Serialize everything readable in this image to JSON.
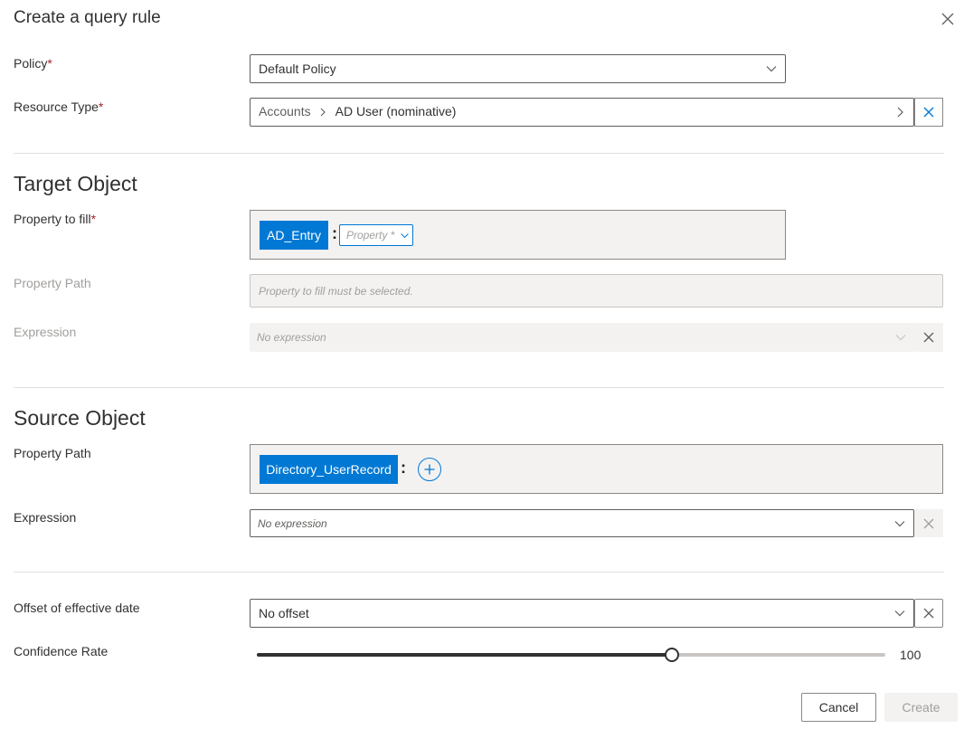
{
  "dialog": {
    "title": "Create a query rule"
  },
  "policy": {
    "label": "Policy",
    "value": "Default Policy"
  },
  "resource_type": {
    "label": "Resource Type",
    "crumb_1": "Accounts",
    "crumb_sep": ">",
    "crumb_2": "AD User (nominative)"
  },
  "target": {
    "heading": "Target Object",
    "property_to_fill_label": "Property to fill",
    "chip": "AD_Entry",
    "colon": ":",
    "property_placeholder": "Property *",
    "property_path_label": "Property Path",
    "property_path_value": "Property to fill must be selected.",
    "expression_label": "Expression",
    "expression_value": "No expression"
  },
  "source": {
    "heading": "Source Object",
    "property_path_label": "Property Path",
    "chip": "Directory_UserRecord",
    "colon": ":",
    "expression_label": "Expression",
    "expression_value": "No expression"
  },
  "offset": {
    "label": "Offset of effective date",
    "value": "No offset"
  },
  "confidence": {
    "label": "Confidence Rate",
    "value": "100",
    "fill_fraction": 0.66
  },
  "buttons": {
    "cancel": "Cancel",
    "create": "Create"
  },
  "required_marker": "*",
  "colors": {
    "accent": "#0078d4",
    "required": "#a4262c"
  },
  "icons": [
    "close-icon",
    "chevron-down-icon",
    "chevron-right-icon",
    "clear-icon",
    "add-icon"
  ]
}
